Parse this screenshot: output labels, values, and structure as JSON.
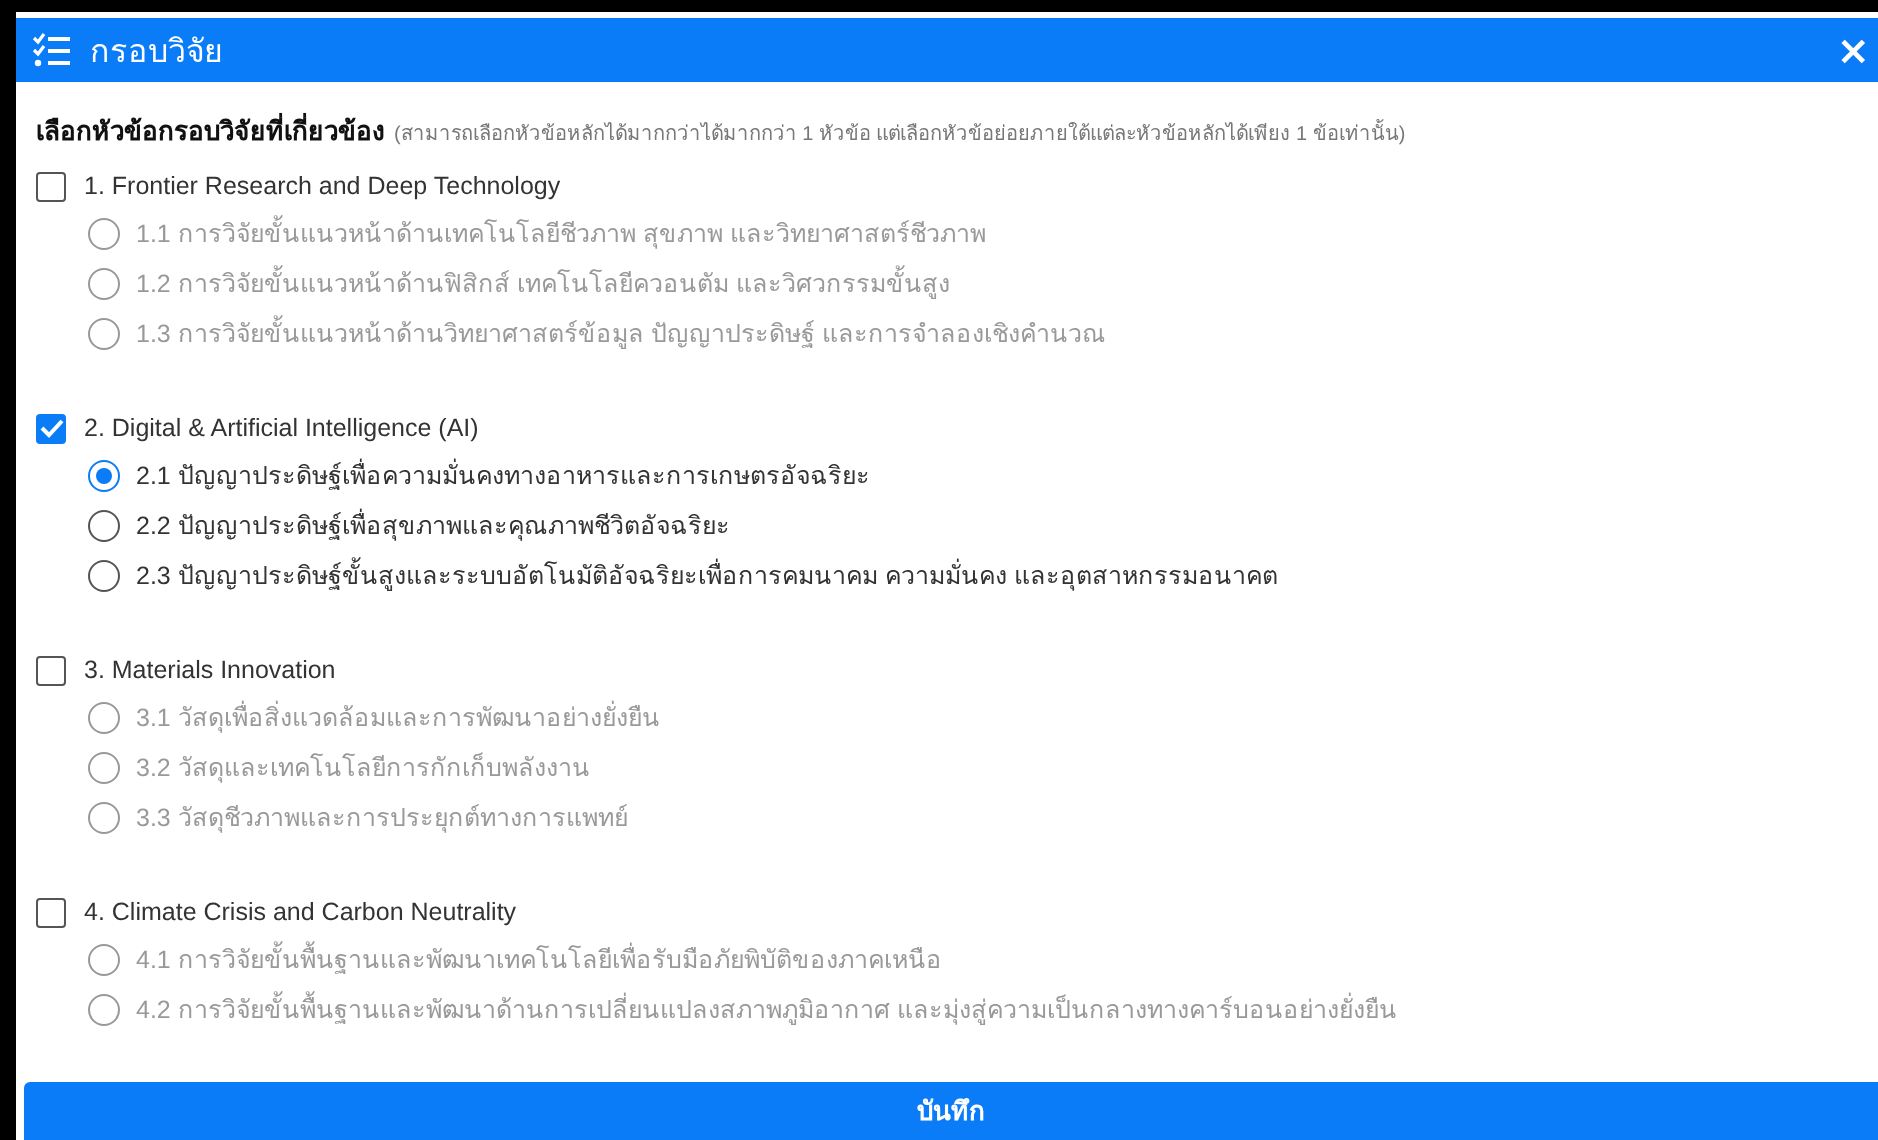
{
  "window": {
    "title": "กรอบวิจัย",
    "close": "×"
  },
  "prompt": {
    "label": "เลือกหัวข้อกรอบวิจัยที่เกี่ยวข้อง",
    "hint": "(สามารถเลือกหัวข้อหลักได้มากกว่าได้มากกว่า 1 หัวข้อ แต่เลือกหัวข้อย่อยภายใต้แต่ละหัวข้อหลักได้เพียง 1 ข้อเท่านั้น)"
  },
  "groups": [
    {
      "label": "1. Frontier Research and Deep Technology",
      "checked": false,
      "options": [
        {
          "label": "1.1 การวิจัยขั้นแนวหน้าด้านเทคโนโลยีชีวภาพ สุขภาพ และวิทยาศาสตร์ชีวภาพ",
          "selected": false
        },
        {
          "label": "1.2 การวิจัยขั้นแนวหน้าด้านฟิสิกส์ เทคโนโลยีควอนตัม และวิศวกรรมขั้นสูง",
          "selected": false
        },
        {
          "label": "1.3 การวิจัยขั้นแนวหน้าด้านวิทยาศาสตร์ข้อมูล ปัญญาประดิษฐ์ และการจำลองเชิงคำนวณ",
          "selected": false
        }
      ]
    },
    {
      "label": "2. Digital & Artificial Intelligence (AI)",
      "checked": true,
      "options": [
        {
          "label": "2.1 ปัญญาประดิษฐ์เพื่อความมั่นคงทางอาหารและการเกษตรอัจฉริยะ",
          "selected": true
        },
        {
          "label": "2.2 ปัญญาประดิษฐ์เพื่อสุขภาพและคุณภาพชีวิตอัจฉริยะ",
          "selected": false
        },
        {
          "label": "2.3 ปัญญาประดิษฐ์ขั้นสูงและระบบอัตโนมัติอัจฉริยะเพื่อการคมนาคม ความมั่นคง และอุตสาหกรรมอนาคต",
          "selected": false
        }
      ]
    },
    {
      "label": "3. Materials Innovation",
      "checked": false,
      "options": [
        {
          "label": "3.1 วัสดุเพื่อสิ่งแวดล้อมและการพัฒนาอย่างยั่งยืน",
          "selected": false
        },
        {
          "label": "3.2 วัสดุและเทคโนโลยีการกักเก็บพลังงาน",
          "selected": false
        },
        {
          "label": "3.3 วัสดุชีวภาพและการประยุกต์ทางการแพทย์",
          "selected": false
        }
      ]
    },
    {
      "label": "4. Climate Crisis and Carbon Neutrality",
      "checked": false,
      "options": [
        {
          "label": "4.1 การวิจัยขั้นพื้นฐานและพัฒนาเทคโนโลยีเพื่อรับมือภัยพิบัติของภาคเหนือ",
          "selected": false
        },
        {
          "label": "4.2 การวิจัยขั้นพื้นฐานและพัฒนาด้านการเปลี่ยนแปลงสภาพภูมิอากาศ และมุ่งสู่ความเป็นกลางทางคาร์บอนอย่างยั่งยืน",
          "selected": false
        }
      ]
    }
  ],
  "save_button": "บันทึก"
}
